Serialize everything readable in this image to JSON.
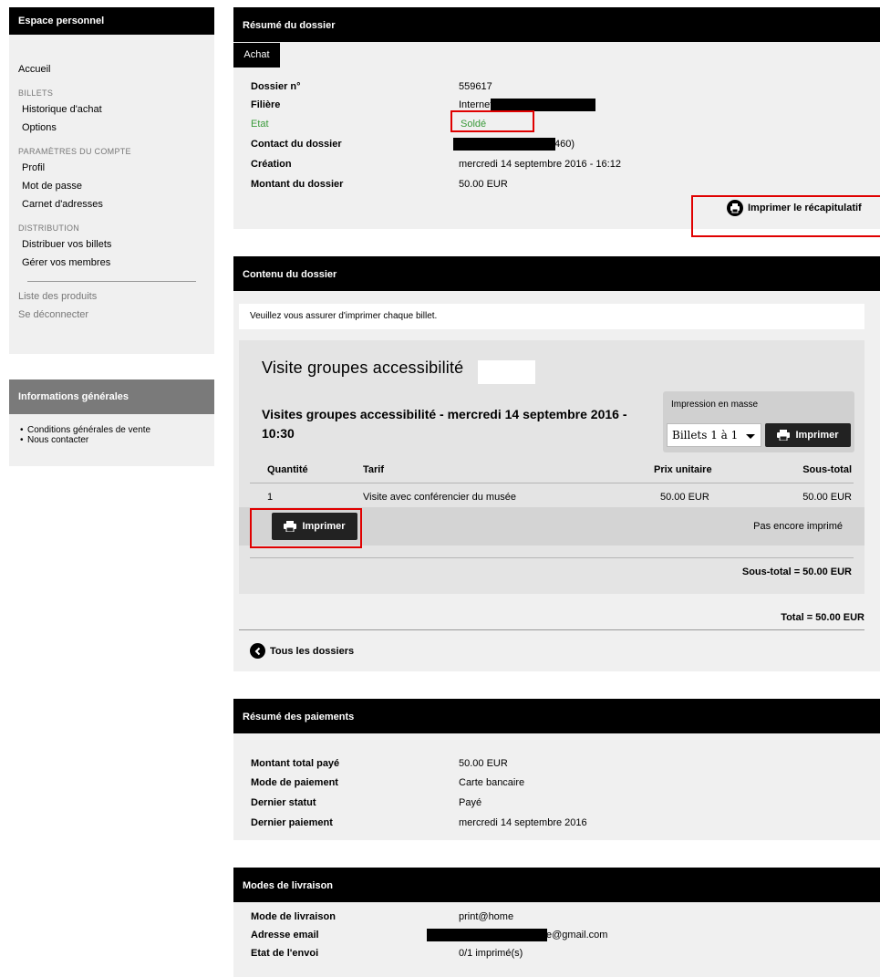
{
  "sidebar": {
    "header": "Espace personnel",
    "home": "Accueil",
    "section_billets": "BILLETS",
    "historique": "Historique d'achat",
    "options": "Options",
    "section_compte": "PARAMÈTRES DU COMPTE",
    "profil": "Profil",
    "mot_de_passe": "Mot de passe",
    "carnet": "Carnet d'adresses",
    "section_distribution": "DISTRIBUTION",
    "distribuer": "Distribuer vos billets",
    "gerer": "Gérer vos membres",
    "liste_produits": "Liste des produits",
    "deconnecter": "Se déconnecter",
    "info_header": "Informations générales",
    "info_items": [
      "Conditions générales de vente",
      "Nous contacter"
    ]
  },
  "summary": {
    "header": "Résumé du dossier",
    "tab": "Achat",
    "dossier_label": "Dossier n°",
    "dossier_value": "559617",
    "filiere_label": "Filière",
    "filiere_value": "Internet",
    "etat_label": "Etat",
    "etat_value": "Soldé",
    "contact_label": "Contact du dossier",
    "contact_value_suffix": "460)",
    "creation_label": "Création",
    "creation_value": "mercredi 14 septembre 2016 - 16:12",
    "montant_label": "Montant du dossier",
    "montant_value": "50.00 EUR",
    "print_summary": "Imprimer le récapitulatif"
  },
  "contents": {
    "header": "Contenu du dossier",
    "note": "Veuillez vous assurer d'imprimer chaque billet.",
    "product_title": "Visite groupes accessibilité",
    "visit_title": "Visites groupes accessibilité - mercredi 14 septembre 2016 - 10:30",
    "mass_print_label": "Impression en masse",
    "mass_select_value": "Billets 1 à 1",
    "mass_print_button": "Imprimer",
    "columns": {
      "quantite": "Quantité",
      "tarif": "Tarif",
      "prix": "Prix unitaire",
      "sous_total": "Sous-total"
    },
    "row": {
      "quantite": "1",
      "tarif": "Visite avec conférencier du musée",
      "prix": "50.00 EUR",
      "sous_total": "50.00 EUR"
    },
    "print_button": "Imprimer",
    "print_status": "Pas encore imprimé",
    "subtotal": "Sous-total = 50.00 EUR",
    "total": "Total = 50.00 EUR",
    "back_link": "Tous les dossiers"
  },
  "payments": {
    "header": "Résumé des paiements",
    "rows": [
      {
        "label": "Montant total payé",
        "value": "50.00 EUR"
      },
      {
        "label": "Mode de paiement",
        "value": "Carte bancaire"
      },
      {
        "label": "Dernier statut",
        "value": "Payé"
      },
      {
        "label": "Dernier paiement",
        "value": "mercredi 14 septembre 2016"
      }
    ]
  },
  "delivery": {
    "header": "Modes de livraison",
    "rows": [
      {
        "label": "Mode de livraison",
        "value": "print@home"
      },
      {
        "label": "Adresse email",
        "value": "e@gmail.com"
      },
      {
        "label": "Etat de l'envoi",
        "value": "0/1 imprimé(s)"
      }
    ]
  },
  "colors": {
    "accent_green": "#3a9a3a",
    "highlight_red": "#e00000",
    "header_black": "#000000",
    "panel_grey": "#f0f0f0"
  },
  "icons": {
    "print": "printer-icon",
    "back": "chevron-left-icon",
    "dropdown": "caret-down-icon"
  }
}
